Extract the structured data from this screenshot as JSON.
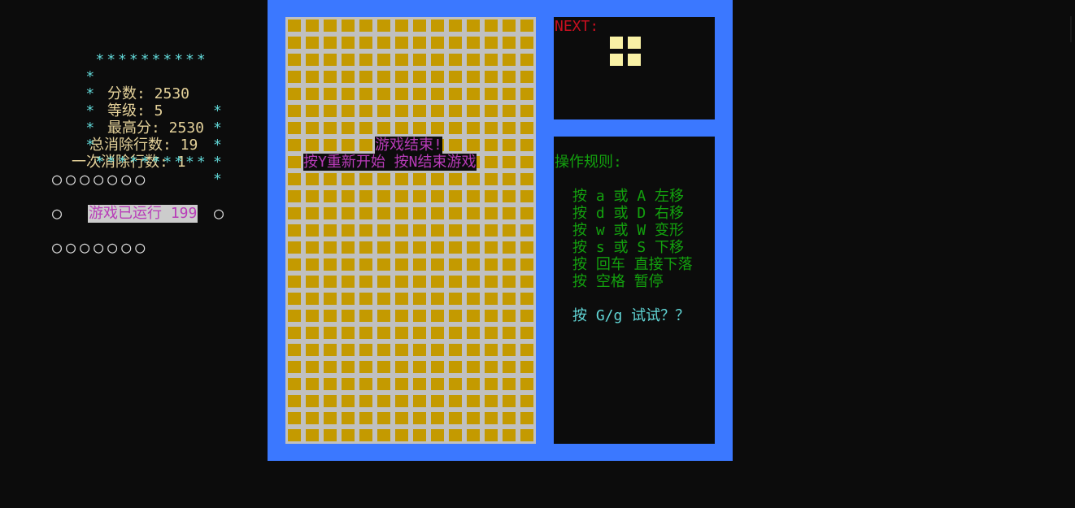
{
  "stats": {
    "star_row": "**********",
    "score_label": "分数: 2530",
    "level_label": "等级: 5",
    "high_score_label": "最高分: 2530",
    "total_lines_label": "总消除行数: 19",
    "single_lines_label": "一次消除行数: 1"
  },
  "circles": {
    "row": "○○○○○○○",
    "side": "○"
  },
  "runtime": "游戏已运行 199",
  "board": {
    "columns": 14,
    "rows": 25,
    "game_over_title": "游戏结束!",
    "game_over_prompt": "按Y重新开始 按N结束游戏"
  },
  "next": {
    "label": "NEXT:",
    "piece_type": "O"
  },
  "rules": {
    "title": "操作规则:",
    "items": [
      "按 a 或 A 左移",
      "按 d 或 D 右移",
      "按 w 或 W 变形",
      "按 s 或 S 下移",
      "按 回车 直接下落",
      "按 空格 暂停"
    ],
    "tip": "按 G/g 试试？？"
  },
  "colors": {
    "background": "#0c0c0c",
    "frame": "#3b78ff",
    "board_bg": "#c0c0c0",
    "block": "#c49a00",
    "next_piece": "#f9f1a5",
    "cyan": "#61d6d6",
    "stat_text": "#e5d29a",
    "magenta": "#b83bb8",
    "green": "#13a10e",
    "red": "#c50f1f"
  }
}
